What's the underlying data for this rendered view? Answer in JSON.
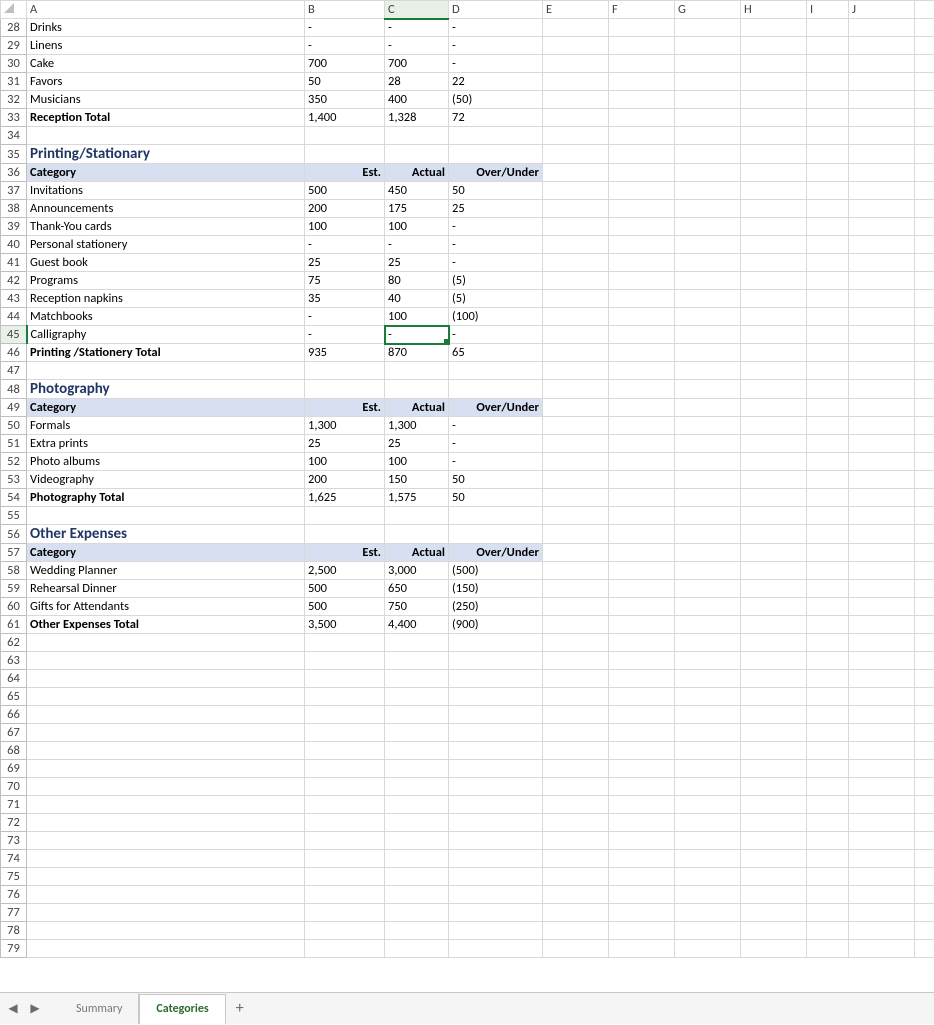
{
  "columns": [
    "A",
    "B",
    "C",
    "D",
    "E",
    "F",
    "G",
    "H",
    "I",
    "J",
    ""
  ],
  "firstRow": 28,
  "lastRow": 79,
  "selectedCell": {
    "row": 45,
    "col": "C"
  },
  "tabs": {
    "prev": "◀",
    "next": "▶",
    "add": "+",
    "items": [
      {
        "label": "Summary",
        "active": false
      },
      {
        "label": "Categories",
        "active": true
      }
    ]
  },
  "rows": {
    "28": {
      "A": "Drinks",
      "B": "-",
      "C": "-",
      "D": "-",
      "type": "data"
    },
    "29": {
      "A": "Linens",
      "B": "-",
      "C": "-",
      "D": "-",
      "type": "data"
    },
    "30": {
      "A": "Cake",
      "B": "700",
      "C": "700",
      "D": "-",
      "type": "data"
    },
    "31": {
      "A": "Favors",
      "B": "50",
      "C": "28",
      "D": "22",
      "type": "data"
    },
    "32": {
      "A": "Musicians",
      "B": "350",
      "C": "400",
      "D": "(50)",
      "type": "data",
      "lastBeforeTotal": true
    },
    "33": {
      "A": "Reception Total",
      "B": "1,400",
      "C": "1,328",
      "D": "72",
      "type": "total"
    },
    "34": {
      "type": "blank"
    },
    "35": {
      "A": "Printing/Stationary",
      "type": "section"
    },
    "36": {
      "A": "Category",
      "B": "Est.",
      "C": "Actual",
      "D": "Over/Under",
      "type": "header"
    },
    "37": {
      "A": "Invitations",
      "B": "500",
      "C": "450",
      "D": "50",
      "type": "data"
    },
    "38": {
      "A": "Announcements",
      "B": "200",
      "C": "175",
      "D": "25",
      "type": "data"
    },
    "39": {
      "A": "Thank-You cards",
      "B": "100",
      "C": "100",
      "D": "-",
      "type": "data"
    },
    "40": {
      "A": "Personal stationery",
      "B": "-",
      "C": "-",
      "D": "-",
      "type": "data"
    },
    "41": {
      "A": "Guest book",
      "B": "25",
      "C": "25",
      "D": "-",
      "type": "data"
    },
    "42": {
      "A": "Programs",
      "B": "75",
      "C": "80",
      "D": "(5)",
      "type": "data"
    },
    "43": {
      "A": "Reception napkins",
      "B": "35",
      "C": "40",
      "D": "(5)",
      "type": "data"
    },
    "44": {
      "A": "Matchbooks",
      "B": "-",
      "C": "100",
      "D": "(100)",
      "type": "data"
    },
    "45": {
      "A": "Calligraphy",
      "B": "-",
      "C": "-",
      "D": "-",
      "type": "data",
      "lastBeforeTotal": true
    },
    "46": {
      "A": "Printing /Stationery Total",
      "B": "935",
      "C": "870",
      "D": "65",
      "type": "total"
    },
    "47": {
      "type": "blank"
    },
    "48": {
      "A": "Photography",
      "type": "section"
    },
    "49": {
      "A": "Category",
      "B": "Est.",
      "C": "Actual",
      "D": "Over/Under",
      "type": "header"
    },
    "50": {
      "A": "Formals",
      "B": "1,300",
      "C": "1,300",
      "D": "-",
      "type": "data"
    },
    "51": {
      "A": "Extra prints",
      "B": "25",
      "C": "25",
      "D": "-",
      "type": "data"
    },
    "52": {
      "A": "Photo albums",
      "B": "100",
      "C": "100",
      "D": "-",
      "type": "data"
    },
    "53": {
      "A": "Videography",
      "B": "200",
      "C": "150",
      "D": "50",
      "type": "data",
      "lastBeforeTotal": true
    },
    "54": {
      "A": "Photography Total",
      "B": "1,625",
      "C": "1,575",
      "D": "50",
      "type": "total"
    },
    "55": {
      "type": "blank"
    },
    "56": {
      "A": "Other Expenses",
      "type": "section"
    },
    "57": {
      "A": "Category",
      "B": "Est.",
      "C": "Actual",
      "D": "Over/Under",
      "type": "header"
    },
    "58": {
      "A": "Wedding Planner",
      "B": "2,500",
      "C": "3,000",
      "D": "(500)",
      "type": "data"
    },
    "59": {
      "A": "Rehearsal Dinner",
      "B": "500",
      "C": "650",
      "D": "(150)",
      "type": "data"
    },
    "60": {
      "A": "Gifts for Attendants",
      "B": "500",
      "C": "750",
      "D": "(250)",
      "type": "data",
      "lastBeforeTotal": true
    },
    "61": {
      "A": "Other Expenses Total",
      "B": "3,500",
      "C": "4,400",
      "D": "(900)",
      "type": "total"
    }
  }
}
